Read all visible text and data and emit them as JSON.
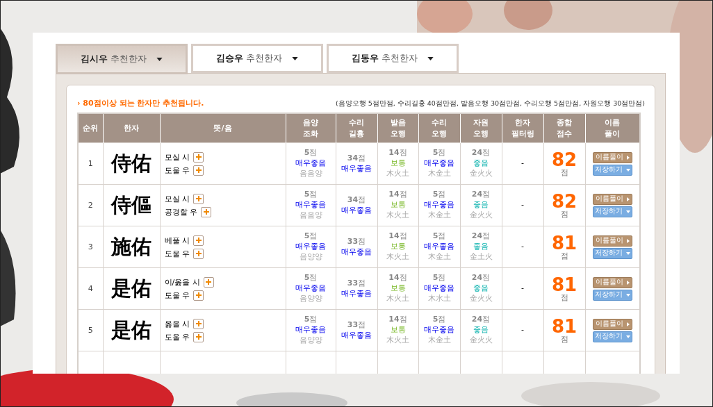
{
  "tabs": [
    {
      "name": "김시우",
      "label": "추천한자",
      "selected": true
    },
    {
      "name": "김승우",
      "label": "추천한자",
      "selected": false
    },
    {
      "name": "김동우",
      "label": "추천한자",
      "selected": false
    }
  ],
  "notice": "› 80점이상 되는 한자만 추천됩니다.",
  "criteria": "(음양오행 5점만점, 수리길흉 40점만점, 발음오행 30점만점, 수리오행 5점만점, 자원오행 30점만점)",
  "table": {
    "columns": [
      "순위",
      "한자",
      "뜻/음",
      "음양\n조화",
      "수리\n길흉",
      "발음\n오행",
      "수리\n오행",
      "자원\n오행",
      "한자\n필터링",
      "종합\n점수",
      "이름\n풀이"
    ],
    "rows": [
      {
        "rank": "1",
        "hanja": "侍佑",
        "meanings": [
          "모실 시",
          "도울 우"
        ],
        "scores": [
          {
            "score": "**5**점",
            "rating": "매우좋음",
            "kind": "very_good",
            "detail": "음음양"
          },
          {
            "score": "**34**점",
            "rating": "매우좋음",
            "kind": "very_good"
          },
          {
            "score": "**14**점",
            "rating": "보통",
            "kind": "normal",
            "detail": "木火土"
          },
          {
            "score": "**5**점",
            "rating": "매우좋음",
            "kind": "very_good",
            "detail": "木金土"
          },
          {
            "score": "**24**점",
            "rating": "좋음",
            "kind": "good",
            "detail": "金火火"
          }
        ],
        "filter": "-",
        "total": "82",
        "unit": "점",
        "buttons": [
          "이름풀이",
          "저장하기"
        ]
      },
      {
        "rank": "2",
        "hanja": "侍傴",
        "meanings": [
          "모실 시",
          "공경할 우"
        ],
        "scores": [
          {
            "score": "**5**점",
            "rating": "매우좋음",
            "kind": "very_good",
            "detail": "음음양"
          },
          {
            "score": "**34**점",
            "rating": "매우좋음",
            "kind": "very_good"
          },
          {
            "score": "**14**점",
            "rating": "보통",
            "kind": "normal",
            "detail": "木火土"
          },
          {
            "score": "**5**점",
            "rating": "매우좋음",
            "kind": "very_good",
            "detail": "木金土"
          },
          {
            "score": "**24**점",
            "rating": "좋음",
            "kind": "good",
            "detail": "金火火"
          }
        ],
        "filter": "-",
        "total": "82",
        "unit": "점",
        "buttons": [
          "이름풀이",
          "저장하기"
        ]
      },
      {
        "rank": "3",
        "hanja": "施佑",
        "meanings": [
          "베풀 시",
          "도울 우"
        ],
        "scores": [
          {
            "score": "**5**점",
            "rating": "매우좋음",
            "kind": "very_good",
            "detail": "음양양"
          },
          {
            "score": "**33**점",
            "rating": "매우좋음",
            "kind": "very_good"
          },
          {
            "score": "**14**점",
            "rating": "보통",
            "kind": "normal",
            "detail": "木火土"
          },
          {
            "score": "**5**점",
            "rating": "매우좋음",
            "kind": "very_good",
            "detail": "木金土"
          },
          {
            "score": "**24**점",
            "rating": "좋음",
            "kind": "good",
            "detail": "金土火"
          }
        ],
        "filter": "-",
        "total": "81",
        "unit": "점",
        "buttons": [
          "이름풀이",
          "저장하기"
        ]
      },
      {
        "rank": "4",
        "hanja": "是佑",
        "meanings": [
          "이/옳을 시",
          "도울 우"
        ],
        "scores": [
          {
            "score": "**5**점",
            "rating": "매우좋음",
            "kind": "very_good",
            "detail": "음양양"
          },
          {
            "score": "**33**점",
            "rating": "매우좋음",
            "kind": "very_good"
          },
          {
            "score": "**14**점",
            "rating": "보통",
            "kind": "normal",
            "detail": "木火土"
          },
          {
            "score": "**5**점",
            "rating": "매우좋음",
            "kind": "very_good",
            "detail": "木水土"
          },
          {
            "score": "**24**점",
            "rating": "좋음",
            "kind": "good",
            "detail": "金火火"
          }
        ],
        "filter": "-",
        "total": "81",
        "unit": "점",
        "buttons": [
          "이름풀이",
          "저장하기"
        ]
      },
      {
        "rank": "5",
        "hanja": "是佑",
        "meanings": [
          "옳을 시",
          "도울 우"
        ],
        "scores": [
          {
            "score": "**5**점",
            "rating": "매우좋음",
            "kind": "very_good",
            "detail": "음양양"
          },
          {
            "score": "**33**점",
            "rating": "매우좋음",
            "kind": "very_good"
          },
          {
            "score": "**14**점",
            "rating": "보통",
            "kind": "normal",
            "detail": "木火土"
          },
          {
            "score": "**5**점",
            "rating": "매우좋음",
            "kind": "very_good",
            "detail": "木金土"
          },
          {
            "score": "**24**점",
            "rating": "좋음",
            "kind": "good",
            "detail": "金火火"
          }
        ],
        "filter": "-",
        "total": "81",
        "unit": "점",
        "buttons": [
          "이름풀이",
          "저장하기"
        ]
      }
    ]
  }
}
